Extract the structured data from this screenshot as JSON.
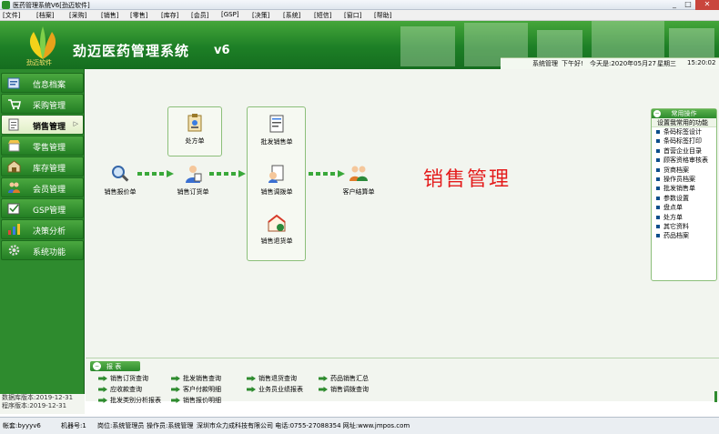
{
  "window": {
    "title": "医药管理系统V6[劲迈软件]",
    "minimize": "_",
    "maximize": "□",
    "close": "✕"
  },
  "menu": [
    "[文件]",
    "[档案]",
    "[采购]",
    "[销售]",
    "[零售]",
    "[库存]",
    "[会员]",
    "[GSP]",
    "[决策]",
    "[系统]",
    "[短信]",
    "[窗口]",
    "[帮助]"
  ],
  "header": {
    "logo_text": "劲迈软件",
    "app_name": "劲迈医药管理系统",
    "version": "v6"
  },
  "status": {
    "user": "系统管理",
    "greeting": "下午好!",
    "date": "今天是:2020年05月27",
    "weekday": "星期三",
    "time": "15:20:02"
  },
  "sidebar": {
    "items": [
      {
        "label": "信息档案",
        "icon": "folder-icon"
      },
      {
        "label": "采购管理",
        "icon": "cart-icon"
      },
      {
        "label": "销售管理",
        "icon": "document-icon",
        "arrow": "▷"
      },
      {
        "label": "零售管理",
        "icon": "shop-icon"
      },
      {
        "label": "库存管理",
        "icon": "warehouse-icon"
      },
      {
        "label": "会员管理",
        "icon": "members-icon"
      },
      {
        "label": "GSP管理",
        "icon": "gsp-icon"
      },
      {
        "label": "决策分析",
        "icon": "chart-icon"
      },
      {
        "label": "系统功能",
        "icon": "gear-icon"
      }
    ]
  },
  "workflow": {
    "quote": "销售报价单",
    "order": "销售订货单",
    "delivery": "处方单",
    "wholesale": "批发销售单",
    "transfer": "销售调拨单",
    "return": "销售退货单",
    "settle": "客户结算单"
  },
  "module_title": "销售管理",
  "common": {
    "header": "常用操作",
    "toggle": "−",
    "subheader": "设置我常用的功能",
    "items": [
      "条码标签设计",
      "条码标签打印",
      "首营企业目录",
      "顾客资格审核表",
      "货商档案",
      "操作员档案",
      "批发销售单",
      "参数设置",
      "盘点单",
      "处方单",
      "其它资料",
      "药品档案"
    ]
  },
  "reports": {
    "header": "报 表",
    "toggle": "−",
    "col1": [
      "销售订货查询",
      "应收款查询",
      "批发类别分析报表"
    ],
    "col2": [
      "批发销售查询",
      "客户付款明细",
      "销售报价明细"
    ],
    "col3": [
      "销售退货查询",
      "业务员业绩报表"
    ],
    "col4": [
      "药品销售汇总",
      "销售调拨查询"
    ]
  },
  "expiry": {
    "line1": "数据库版本:2019-12-31",
    "line2": "程序版本:2019-12-31"
  },
  "bottom": {
    "account": "帐套:byyyv6",
    "machine": "机器号:1",
    "position": "岗位:系统管理员",
    "operator": "操作员:系统管理",
    "company": "深圳市众力成科技有限公司 电话:0755-27088354 网址:www.jmpos.com"
  },
  "colors": {
    "brand_green": "#1d7f26",
    "accent_red": "#e41c1c",
    "panel_border": "#8cbf7a"
  }
}
